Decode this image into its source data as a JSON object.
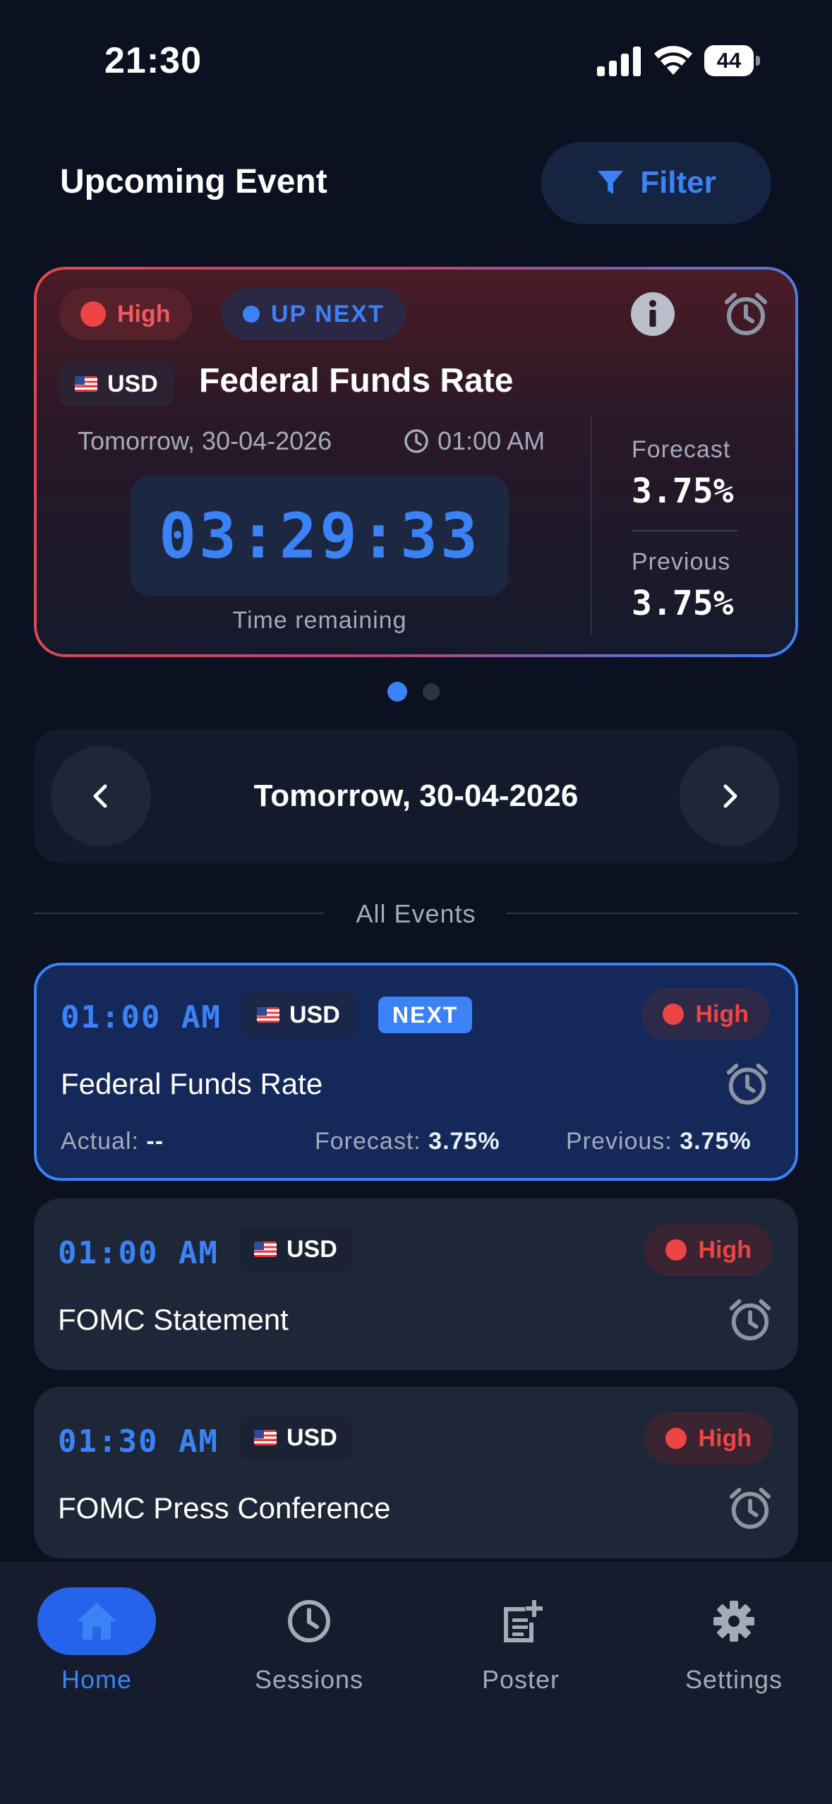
{
  "status_bar": {
    "time": "21:30",
    "battery": "44"
  },
  "header": {
    "title": "Upcoming Event",
    "filter_label": "Filter"
  },
  "hero": {
    "impact": "High",
    "badge": "UP NEXT",
    "currency": "USD",
    "title": "Federal Funds Rate",
    "date": "Tomorrow, 30-04-2026",
    "time": "01:00 AM",
    "countdown": "03:29:33",
    "countdown_caption": "Time remaining",
    "forecast_label": "Forecast",
    "forecast_value": "3.75%",
    "previous_label": "Previous",
    "previous_value": "3.75%"
  },
  "date_nav": {
    "label": "Tomorrow, 30-04-2026"
  },
  "section_label": "All Events",
  "events": [
    {
      "time": "01:00 AM",
      "currency": "USD",
      "badge": "NEXT",
      "impact": "High",
      "title": "Federal Funds Rate",
      "actual_label": "Actual:",
      "actual_value": "--",
      "forecast_label": "Forecast:",
      "forecast_value": "3.75%",
      "previous_label": "Previous:",
      "previous_value": "3.75%"
    },
    {
      "time": "01:00 AM",
      "currency": "USD",
      "impact": "High",
      "title": "FOMC Statement"
    },
    {
      "time": "01:30 AM",
      "currency": "USD",
      "impact": "High",
      "title": "FOMC Press Conference"
    }
  ],
  "bottom_nav": {
    "items": [
      {
        "label": "Home",
        "icon": "home-icon",
        "active": true
      },
      {
        "label": "Sessions",
        "icon": "clock-icon",
        "active": false
      },
      {
        "label": "Poster",
        "icon": "poster-icon",
        "active": false
      },
      {
        "label": "Settings",
        "icon": "gear-icon",
        "active": false
      }
    ]
  },
  "colors": {
    "accent": "#3b82f6",
    "high_impact": "#ef4444",
    "background": "#0b1120",
    "card": "#1e2738"
  }
}
